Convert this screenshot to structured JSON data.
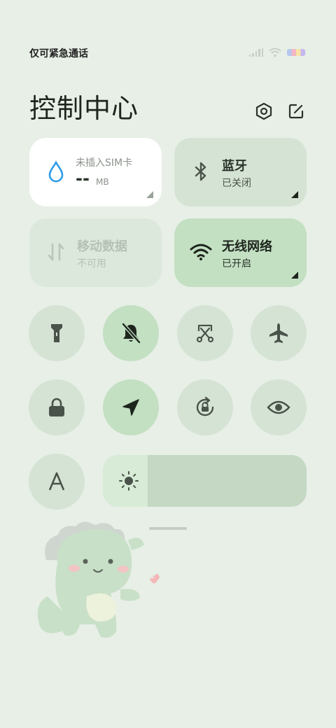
{
  "status": {
    "text": "仅可紧急通话"
  },
  "header": {
    "title": "控制中心",
    "settings_icon": "hexagon-settings-icon",
    "edit_icon": "edit-icon"
  },
  "tiles": {
    "data_usage": {
      "label": "未插入SIM卡",
      "value": "--",
      "unit": "MB"
    },
    "bluetooth": {
      "label": "蓝牙",
      "status": "已关闭"
    },
    "mobile_data": {
      "label": "移动数据",
      "status": "不可用"
    },
    "wifi": {
      "label": "无线网络",
      "status": "已开启"
    }
  },
  "toggles": [
    {
      "name": "flashlight",
      "on": false
    },
    {
      "name": "mute",
      "on": true
    },
    {
      "name": "screenshot",
      "on": false
    },
    {
      "name": "airplane-mode",
      "on": false
    },
    {
      "name": "lock-screen",
      "on": false
    },
    {
      "name": "location",
      "on": true
    },
    {
      "name": "auto-rotate",
      "on": false
    },
    {
      "name": "reading-mode",
      "on": false
    },
    {
      "name": "font-size",
      "on": false
    }
  ],
  "brightness": {
    "level": 0.22
  },
  "colors": {
    "accent_active": "#c3e0c2",
    "tile_bg": "#d5e3d4",
    "background": "#e7efe6",
    "drop_blue": "#2d9be8"
  }
}
